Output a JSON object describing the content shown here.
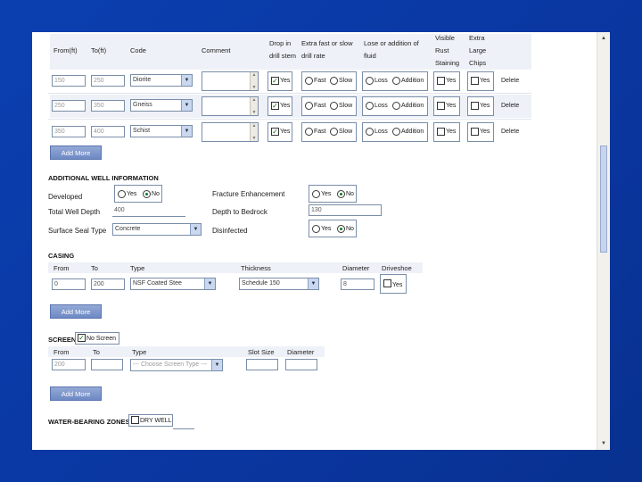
{
  "drill": {
    "headers": {
      "from": "From(ft)",
      "to": "To(ft)",
      "code": "Code",
      "comment": "Comment",
      "drop_in_drill_stem": [
        "Drop in",
        "drill stem"
      ],
      "extra_fast_slow": [
        "Extra fast or slow",
        "drill rate"
      ],
      "loss_or_addition": [
        "Lose or addition of",
        "fluid"
      ],
      "visible_rust": [
        "Visible",
        "Rust",
        "Staining"
      ],
      "extra_large_chips": [
        "Extra",
        "Large",
        "Chips"
      ]
    },
    "rows": [
      {
        "from": "150",
        "to": "250",
        "code": "Diorite",
        "drop_label": "Yes",
        "drop_checked": true,
        "fast": "Fast",
        "slow": "Slow",
        "loss": "Loss",
        "addition": "Addition",
        "rust_label": "Yes",
        "chips_label": "Yes",
        "delete": "Delete"
      },
      {
        "from": "250",
        "to": "350",
        "code": "Gneiss",
        "drop_label": "Yes",
        "drop_checked": true,
        "fast": "Fast",
        "slow": "Slow",
        "loss": "Loss",
        "addition": "Addition",
        "rust_label": "Yes",
        "chips_label": "Yes",
        "delete": "Delete"
      },
      {
        "from": "350",
        "to": "400",
        "code": "Schist",
        "drop_label": "Yes",
        "drop_checked": true,
        "fast": "Fast",
        "slow": "Slow",
        "loss": "Loss",
        "addition": "Addition",
        "rust_label": "Yes",
        "chips_label": "Yes",
        "delete": "Delete"
      }
    ],
    "add_more": "Add More"
  },
  "additional": {
    "title": "ADDITIONAL WELL INFORMATION",
    "developed_label": "Developed",
    "developed_yes": "Yes",
    "developed_no": "No",
    "fracture_label": "Fracture Enhancement",
    "fracture_yes": "Yes",
    "fracture_no": "No",
    "total_depth_label": "Total Well Depth",
    "total_depth_value": "400",
    "depth_bedrock_label": "Depth to Bedrock",
    "depth_bedrock_value": "130",
    "surface_seal_label": "Surface Seal Type",
    "surface_seal_value": "Concrete",
    "disinfected_label": "Disinfected",
    "disinfected_yes": "Yes",
    "disinfected_no": "No"
  },
  "casing": {
    "title": "CASING",
    "headers": {
      "from": "From",
      "to": "To",
      "type": "Type",
      "thickness": "Thickness",
      "diameter": "Diameter",
      "driveshoe": "Driveshoe"
    },
    "row": {
      "from": "0",
      "to": "200",
      "type": "NSF Coated Stee",
      "thickness": "Schedule 150",
      "diameter": "8",
      "driveshoe_label": "Yes"
    },
    "add_more": "Add More"
  },
  "screen": {
    "title": "SCREEN",
    "no_screen_label": "No Screen",
    "headers": {
      "from": "From",
      "to": "To",
      "type": "Type",
      "slot_size": "Slot Size",
      "diameter": "Diameter"
    },
    "row": {
      "from": "200",
      "to": "",
      "type": "--- Choose Screen Type ---",
      "slot_size": "",
      "diameter": ""
    },
    "add_more": "Add More"
  },
  "water": {
    "title": "WATER-BEARING ZONES",
    "dry_well_label": "DRY WELL"
  },
  "scrollbar": {
    "up": "▲",
    "down": "▼"
  },
  "colors": {
    "background": "#0a3aa8",
    "button": "#7d96cc",
    "check": "#0a6a14",
    "row_band": "#eef1f7"
  }
}
